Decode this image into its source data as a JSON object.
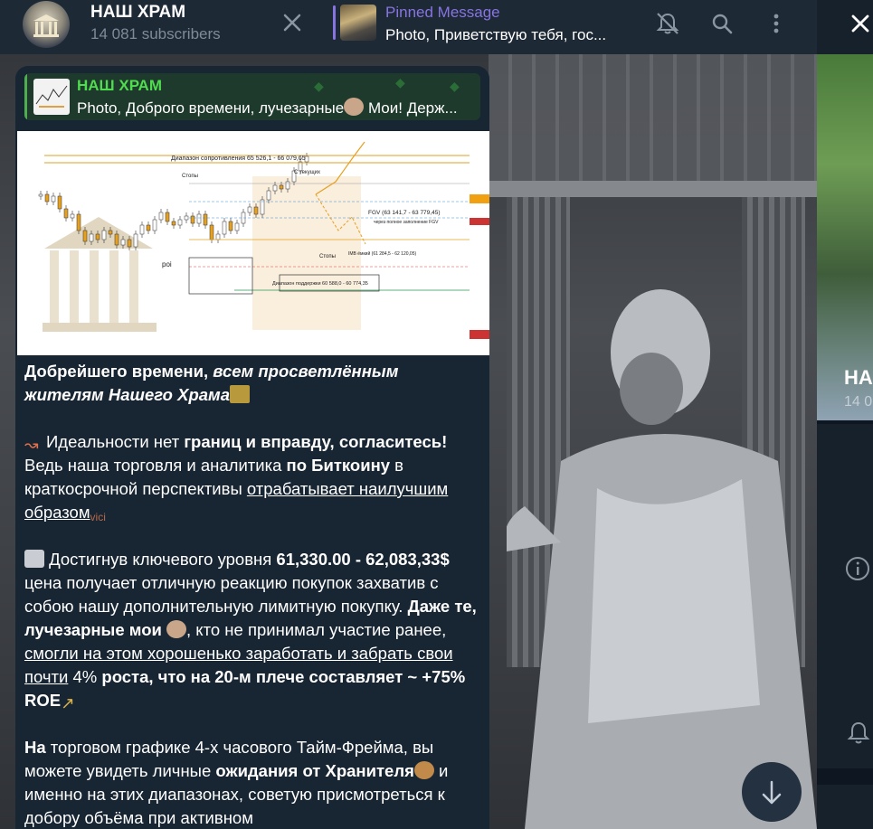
{
  "header": {
    "channel_title": "НАШ ХРАМ",
    "subscribers": "14 081 subscribers",
    "pinned_label": "Pinned Message",
    "pinned_text": "Photo, Приветствую тебя, гос..."
  },
  "message": {
    "reply_author": "НАШ ХРАМ",
    "reply_text": "Photo, Доброго времени, лучезарные",
    "reply_text_tail": " Мои! Держ...",
    "p1_a": "Добрейшего времени,",
    "p1_b": " всем просветлённым жителям Нашего Храма",
    "p2_a": "Идеальности нет ",
    "p2_b": "границ и вправду, согласитесь!",
    "p2_c": " Ведь наша торговля и аналитика ",
    "p2_d": "по Биткоину",
    "p2_e": " в краткосрочной перспективы ",
    "p2_f": "отрабатывает наилучшим образом",
    "p3_a": " Достигнув ключевого уровня  ",
    "p3_b": "61,330.00 - 62,083,33$",
    "p3_c": " цена получает отличную реакцию покупок захватив с собою нашу дополнительную лимитную покупку. ",
    "p3_d": "Даже те, лучезарные мои ",
    "p3_e": ", кто не принимал участие ранее, ",
    "p3_f": "смогли на этом хорошенько заработать и забрать свои почти",
    "p3_g": " 4%",
    "p3_h": " роста, что на 20-м плече составляет ~ +75% ROE",
    "p4_a": "На",
    "p4_b": " торговом графике 4-х часового Тайм-Фрейма, вы можете увидеть личные ",
    "p4_c": "ожидания от Хранителя",
    "p4_d": " и именно на этих диапазонах, советую присмотреться к добору объёма при активном"
  },
  "chart_data": {
    "type": "line",
    "title": "",
    "annotations": [
      "Диапазон сопротивления 65 526,1 - 66 079,65",
      "С текущих",
      "Стопы",
      "FGV (63 141,7 - 63 779,45)",
      "через полное заполнение FGV",
      "Стопы",
      "IMB ёмкий (61 284,5 - 62 120,05)",
      "poi",
      "Диапазон поддержки 60 588,0 - 60 774,35"
    ]
  },
  "right_panel": {
    "name": "НА",
    "sub": "14 0"
  },
  "colors": {
    "accent": "#8774e1",
    "reply_green": "#4fdc4e",
    "bubble": "#182533"
  }
}
